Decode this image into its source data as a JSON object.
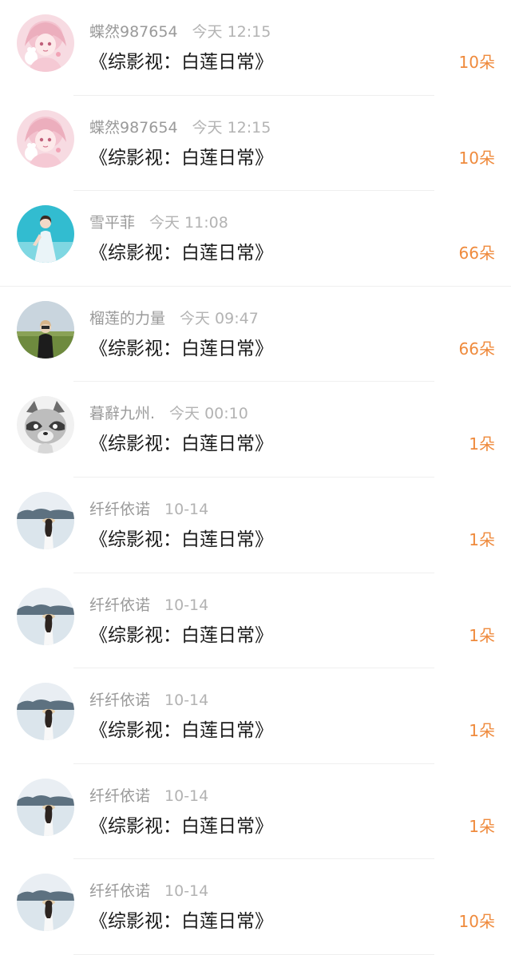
{
  "entries": [
    {
      "name": "蝶然987654",
      "time": "今天 12:15",
      "title": "《综影视：白莲日常》",
      "amount": "10朵",
      "avatar_icon": "anime-girl-avatar-icon"
    },
    {
      "name": "蝶然987654",
      "time": "今天 12:15",
      "title": "《综影视：白莲日常》",
      "amount": "10朵",
      "avatar_icon": "anime-girl-avatar-icon"
    },
    {
      "name": "雪平菲",
      "time": "今天 11:08",
      "title": "《综影视：白莲日常》",
      "amount": "66朵",
      "avatar_icon": "girl-blue-dress-avatar-icon"
    },
    {
      "name": "榴莲的力量",
      "time": "今天 09:47",
      "title": "《综影视：白莲日常》",
      "amount": "66朵",
      "avatar_icon": "person-field-avatar-icon"
    },
    {
      "name": "暮辭九州.",
      "time": "今天 00:10",
      "title": "《综影视：白莲日常》",
      "amount": "1朵",
      "avatar_icon": "raccoon-avatar-icon"
    },
    {
      "name": "纤纤依诺",
      "time": "10-14",
      "title": "《综影视：白莲日常》",
      "amount": "1朵",
      "avatar_icon": "girl-seaside-avatar-icon"
    },
    {
      "name": "纤纤依诺",
      "time": "10-14",
      "title": "《综影视：白莲日常》",
      "amount": "1朵",
      "avatar_icon": "girl-seaside-avatar-icon"
    },
    {
      "name": "纤纤依诺",
      "time": "10-14",
      "title": "《综影视：白莲日常》",
      "amount": "1朵",
      "avatar_icon": "girl-seaside-avatar-icon"
    },
    {
      "name": "纤纤依诺",
      "time": "10-14",
      "title": "《综影视：白莲日常》",
      "amount": "1朵",
      "avatar_icon": "girl-seaside-avatar-icon"
    },
    {
      "name": "纤纤依诺",
      "time": "10-14",
      "title": "《综影视：白莲日常》",
      "amount": "10朵",
      "avatar_icon": "girl-seaside-avatar-icon"
    }
  ],
  "colors": {
    "amount": "#ef8a3c",
    "name": "#9a9a9a",
    "title": "#1a1a1a",
    "divider": "#efefef"
  }
}
